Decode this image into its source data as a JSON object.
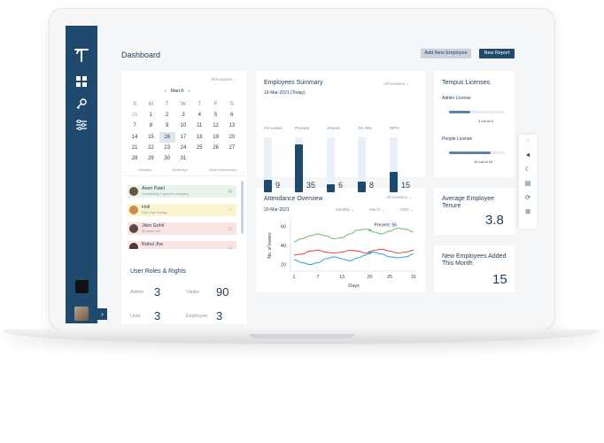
{
  "page": {
    "title": "Dashboard"
  },
  "header": {
    "add_employee": "Add New Employee",
    "new_report": "New Report"
  },
  "sidebar": {
    "icons": [
      "tempus-logo",
      "dashboard-icon",
      "key-icon",
      "settings-sliders-icon"
    ]
  },
  "calendar": {
    "location": "All locations",
    "month": "March",
    "weekdays": [
      "S",
      "M",
      "T",
      "W",
      "T",
      "F",
      "S"
    ],
    "weeks": [
      [
        "",
        "",
        "",
        "",
        "",
        "",
        ""
      ],
      [
        "28",
        "1",
        "2",
        "3",
        "4",
        "5",
        "6"
      ],
      [
        "7",
        "8",
        "9",
        "10",
        "11",
        "12",
        "13"
      ],
      [
        "14",
        "15",
        "16",
        "17",
        "18",
        "19",
        "20"
      ],
      [
        "21",
        "22",
        "23",
        "24",
        "25",
        "26",
        "27"
      ],
      [
        "28",
        "29",
        "30",
        "31",
        "",
        "",
        ""
      ]
    ],
    "legend": [
      "Holidays",
      "Birthdays",
      "Work Anniversary"
    ]
  },
  "events": [
    {
      "title": "Aneri Patel",
      "subtitle": "Completing 2 years in company",
      "color": "#e8f4ea"
    },
    {
      "title": "Holi",
      "subtitle": "One Day Holiday",
      "color": "#fbf5cf"
    },
    {
      "title": "Jiten Gohil",
      "subtitle": "30 years old",
      "color": "#f9e3e3"
    },
    {
      "title": "Rahul Jha",
      "subtitle": "",
      "color": "#f9e3e3"
    }
  ],
  "roles": {
    "title": "User Roles & Rights",
    "items": [
      {
        "label": "Admin",
        "value": "3"
      },
      {
        "label": "Visitor",
        "value": "90"
      },
      {
        "label": "User",
        "value": "3"
      },
      {
        "label": "Employee",
        "value": "3"
      }
    ]
  },
  "summary": {
    "title": "Employees Summary",
    "location": "All locations",
    "date": "19-Mar-2021 (Today)",
    "bars": [
      {
        "label": "On Leave",
        "value": 9
      },
      {
        "label": "Present",
        "value": 35
      },
      {
        "label": "Absent",
        "value": 6
      },
      {
        "label": "On Site",
        "value": 8
      },
      {
        "label": "WFH",
        "value": 15
      }
    ]
  },
  "attendance": {
    "title": "Attendance Overview",
    "location": "All locations",
    "date": "20-Mar-2021",
    "filters": [
      "Monthly",
      "March",
      "2021"
    ],
    "tooltip": "Present: 56"
  },
  "chart_data": {
    "type": "line",
    "title": "",
    "xlabel": "Days",
    "ylabel": "No. of leaves",
    "x": [
      1,
      3,
      5,
      7,
      9,
      11,
      13,
      15,
      17,
      19,
      20,
      21,
      23,
      25,
      27,
      29,
      31
    ],
    "xticks": [
      1,
      7,
      13,
      20,
      25,
      31
    ],
    "yticks": [
      20,
      40,
      60
    ],
    "ylim": [
      15,
      65
    ],
    "series": [
      {
        "color": "#6fc47a",
        "values": [
          44,
          47,
          50,
          52,
          50,
          47,
          48,
          52,
          56,
          57,
          56,
          54,
          52,
          55,
          58,
          57,
          54
        ]
      },
      {
        "color": "#e25555",
        "values": [
          30,
          31,
          34,
          35,
          33,
          32,
          33,
          35,
          34,
          32,
          33,
          35,
          36,
          34,
          32,
          33,
          35
        ]
      },
      {
        "color": "#3ba7e0",
        "values": [
          25,
          22,
          20,
          22,
          26,
          28,
          26,
          24,
          27,
          30,
          32,
          33,
          31,
          28,
          27,
          28,
          31
        ]
      }
    ],
    "grid": false
  },
  "licenses": {
    "title": "Tempus Licenses",
    "items": [
      {
        "label": "Admin License",
        "text": "3 out of 8",
        "fraction": 0.375
      },
      {
        "label": "People License",
        "text": "15 out of 20",
        "fraction": 0.75
      }
    ]
  },
  "tenure": {
    "title": "Average Employee Tenure",
    "value": "3.8"
  },
  "new_employees": {
    "title": "New Employees Added This Month",
    "value": "15"
  },
  "tools": [
    "chat-icon",
    "megaphone-icon",
    "moon-icon",
    "book-icon",
    "sync-icon",
    "translate-icon"
  ]
}
